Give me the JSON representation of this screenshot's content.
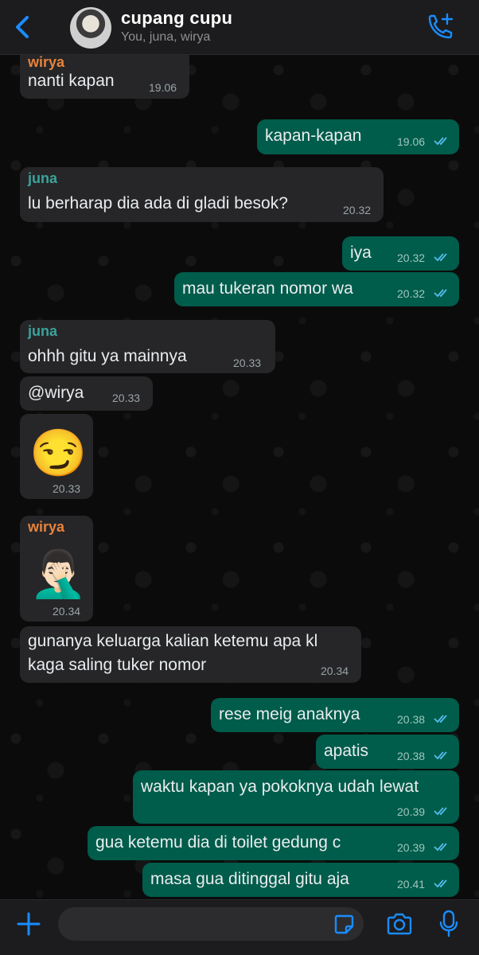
{
  "header": {
    "title": "cupang cupu",
    "subtitle": "You, juna, wirya"
  },
  "colors": {
    "accent": "#1a8cff",
    "outgoing_bubble": "#005c4b",
    "incoming_bubble": "#262628",
    "name_wirya": "#e8833a",
    "name_juna": "#3ba39a",
    "read_tick": "#53bdeb"
  },
  "messages": [
    {
      "sender": "wirya",
      "text": "nanti kapan",
      "time": "19.06"
    },
    {
      "text": "kapan-kapan",
      "time": "19.06"
    },
    {
      "sender": "juna",
      "text": "lu berharap dia ada di gladi besok?",
      "time": "20.32"
    },
    {
      "text": "iya",
      "time": "20.32"
    },
    {
      "text": "mau tukeran nomor wa",
      "time": "20.32"
    },
    {
      "sender": "juna",
      "text": "ohhh gitu ya mainnya",
      "time": "20.33"
    },
    {
      "text": "@wirya",
      "time": "20.33"
    },
    {
      "emoji": "😏",
      "time": "20.33"
    },
    {
      "sender": "wirya",
      "emoji": "🤦🏻‍♂️",
      "time": "20.34"
    },
    {
      "text_lines": [
        "gunanya keluarga kalian ketemu apa kl",
        "kaga saling tuker nomor"
      ],
      "time": "20.34"
    },
    {
      "text": "rese meig anaknya",
      "time": "20.38"
    },
    {
      "text": "apatis",
      "time": "20.38"
    },
    {
      "text": "waktu kapan ya pokoknya udah lewat",
      "time": "20.39"
    },
    {
      "text": "gua ketemu dia di toilet gedung c",
      "time": "20.39"
    },
    {
      "text": "masa gua ditinggal gitu aja",
      "time": "20.41"
    }
  ],
  "composer": {
    "placeholder": ""
  },
  "icons": [
    "back-icon",
    "video-call-icon",
    "plus-icon",
    "sticker-icon",
    "camera-icon",
    "mic-icon",
    "read-receipt-icon"
  ]
}
